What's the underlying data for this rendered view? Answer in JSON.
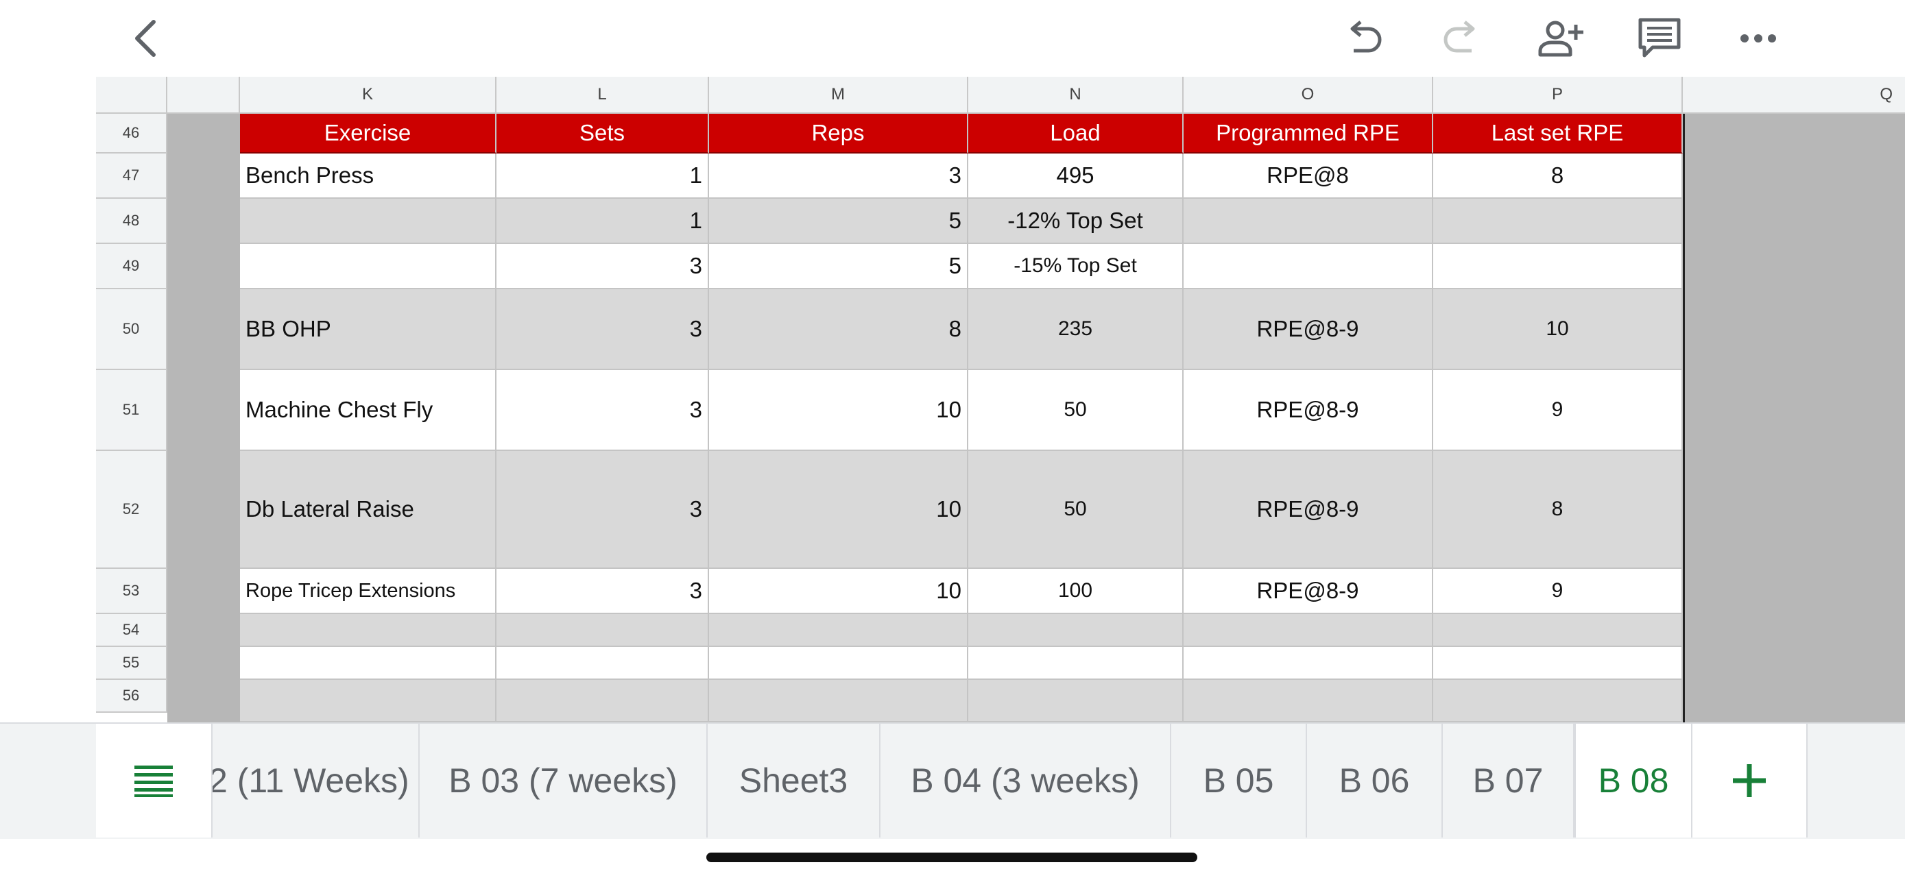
{
  "toolbar": {
    "back": "chevron-left-icon",
    "undo": "undo-icon",
    "redo": "redo-icon",
    "share": "add-person-icon",
    "comments": "comment-icon",
    "more": "more-horizontal-icon"
  },
  "columns": [
    "K",
    "L",
    "M",
    "N",
    "O",
    "P",
    "Q"
  ],
  "rows": [
    "46",
    "47",
    "48",
    "49",
    "50",
    "51",
    "52",
    "53",
    "54",
    "55",
    "56"
  ],
  "table": {
    "header": [
      "Exercise",
      "Sets",
      "Reps",
      "Load",
      "Programmed RPE",
      "Last set RPE"
    ],
    "r47": [
      "Bench Press",
      "1",
      "3",
      "495",
      "RPE@8",
      "8"
    ],
    "r48": [
      "",
      "1",
      "5",
      "-12% Top Set",
      "",
      ""
    ],
    "r49": [
      "",
      "3",
      "5",
      "-15% Top Set",
      "",
      ""
    ],
    "r50": [
      "BB OHP",
      "3",
      "8",
      "235",
      "RPE@8-9",
      "10"
    ],
    "r51": [
      "Machine Chest Fly",
      "3",
      "10",
      "50",
      "RPE@8-9",
      "9"
    ],
    "r52": [
      "Db Lateral Raise",
      "3",
      "10",
      "50",
      "RPE@8-9",
      "8"
    ],
    "r53": [
      "Rope Tricep Extensions",
      "3",
      "10",
      "100",
      "RPE@8-9",
      "9"
    ]
  },
  "tabs": {
    "menu_icon": "sheet-list-icon",
    "t1": "2 (11 Weeks)",
    "t2": "B 03 (7 weeks)",
    "t3": "Sheet3",
    "t4": "B 04 (3 weeks)",
    "t5": "B 05",
    "t6": "B 06",
    "t7": "B 07",
    "t8": "B 08",
    "add_icon": "plus-icon"
  },
  "colors": {
    "header_red": "#cc0000",
    "band_grey": "#d9d9d9",
    "active_tab": "#188038"
  }
}
